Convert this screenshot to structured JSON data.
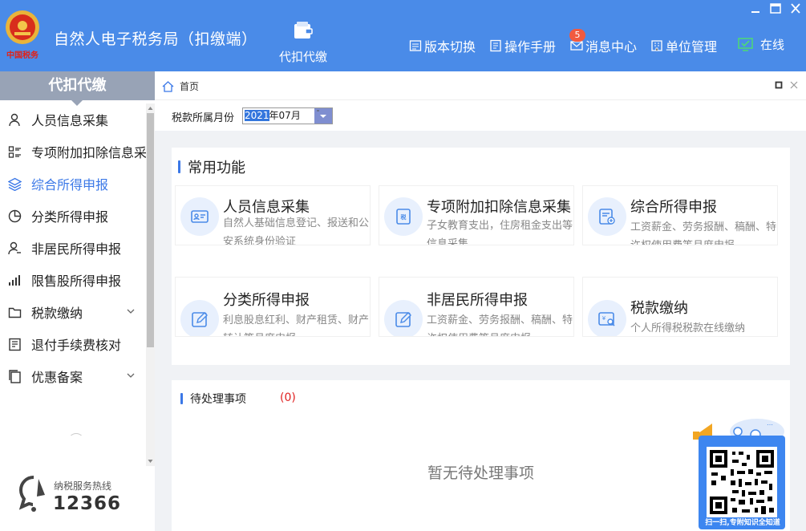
{
  "header": {
    "logo_text": "中国税务",
    "app_title": "自然人电子税务局（扣缴端）",
    "module_label": "代扣代缴",
    "links": [
      {
        "label": "版本切换",
        "icon": "swap-icon"
      },
      {
        "label": "操作手册",
        "icon": "manual-icon"
      },
      {
        "label": "消息中心",
        "icon": "mail-icon"
      },
      {
        "label": "单位管理",
        "icon": "building-icon"
      }
    ],
    "message_badge": "5",
    "status_label": "在线"
  },
  "sidebar": {
    "title": "代扣代缴",
    "items": [
      {
        "label": "人员信息采集",
        "icon": "person-icon",
        "active": false
      },
      {
        "label": "专项附加扣除信息采集",
        "icon": "list-icon",
        "active": false
      },
      {
        "label": "综合所得申报",
        "icon": "layers-icon",
        "active": true
      },
      {
        "label": "分类所得申报",
        "icon": "pie-icon",
        "active": false
      },
      {
        "label": "非居民所得申报",
        "icon": "person-outline-icon",
        "active": false
      },
      {
        "label": "限售股所得申报",
        "icon": "bar-chart-icon",
        "active": false
      },
      {
        "label": "税款缴纳",
        "icon": "folder-icon",
        "active": false,
        "expandable": true
      },
      {
        "label": "退付手续费核对",
        "icon": "document-icon",
        "active": false
      },
      {
        "label": "优惠备案",
        "icon": "copy-icon",
        "active": false,
        "expandable": true
      }
    ],
    "hotline_label": "纳税服务热线",
    "hotline_number": "12366"
  },
  "tabs": {
    "home_label": "首页"
  },
  "period": {
    "label": "税款所属月份",
    "year": "2021",
    "rest": "年07月"
  },
  "common_functions": {
    "title": "常用功能",
    "items": [
      {
        "title": "人员信息采集",
        "desc": "自然人基础信息登记、报送和公安系统身份验证",
        "icon": "id-card-icon"
      },
      {
        "title": "专项附加扣除信息采集",
        "desc": "子女教育支出，住房租金支出等信息采集",
        "icon": "tax-form-icon"
      },
      {
        "title": "综合所得申报",
        "desc": "工资薪金、劳务报酬、稿酬、特许权使用费等月度申报",
        "icon": "report-plus-icon"
      },
      {
        "title": "分类所得申报",
        "desc": "利息股息红利、财产租赁、财产转让等月度申报",
        "icon": "edit-icon"
      },
      {
        "title": "非居民所得申报",
        "desc": "工资薪金、劳务报酬、稿酬、特许权使用费等月度申报",
        "icon": "edit-icon"
      },
      {
        "title": "税款缴纳",
        "desc": "个人所得税税款在线缴纳",
        "icon": "payment-search-icon"
      }
    ]
  },
  "pending": {
    "title": "待处理事项",
    "count": "(0)",
    "empty_text": "暂无待处理事项"
  },
  "qr_widget": {
    "caption": "扫一扫,专附知识全知道"
  },
  "colors": {
    "header_bg": "#4a8be8",
    "accent": "#3b78e7",
    "sidebar_head": "#98a3b6",
    "pending_count": "#e02020"
  }
}
